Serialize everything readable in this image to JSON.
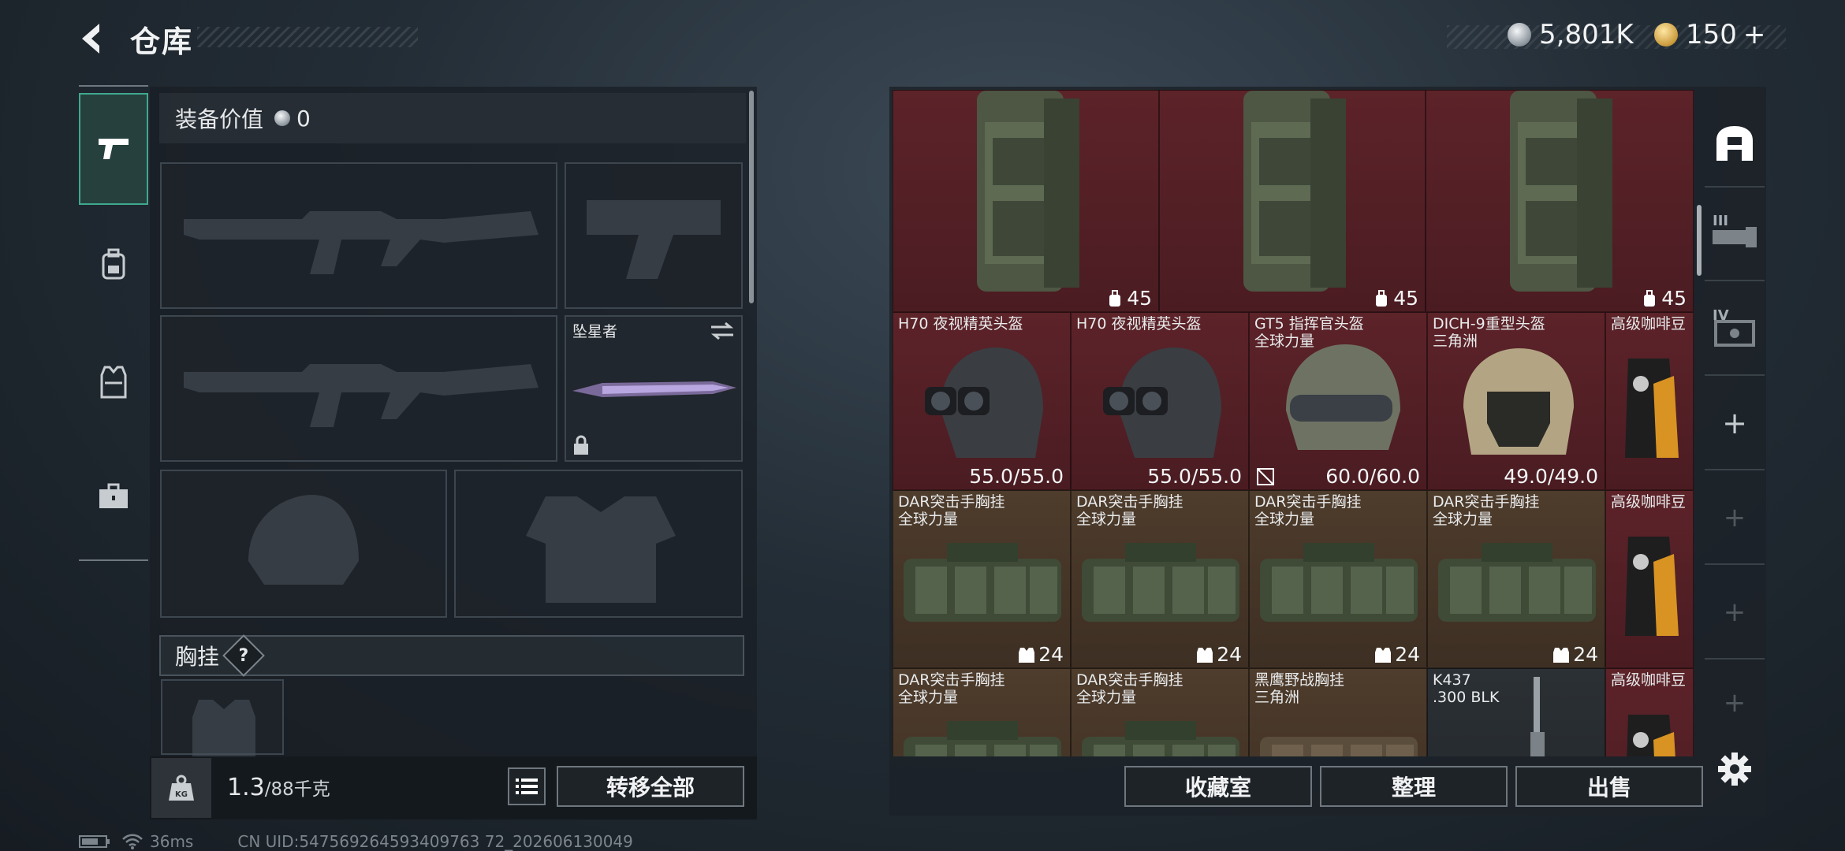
{
  "header": {
    "title": "仓库",
    "silver": "5,801K",
    "gold": "150",
    "add_label": "+"
  },
  "left_panel": {
    "value_label": "装备价值",
    "value_amount": "0",
    "melee_name": "坠星者",
    "chest_rig_label": "胸挂",
    "chest_rig_help": "?",
    "weight_current": "1.3",
    "weight_max": "/88千克",
    "weight_icon_text": "KG",
    "transfer_all": "转移全部"
  },
  "grid": {
    "rows": [
      [
        {
          "name": "",
          "value": "45",
          "badge": "backpack",
          "bg": "red"
        },
        {
          "name": "",
          "value": "45",
          "badge": "backpack",
          "bg": "red"
        },
        {
          "name": "",
          "value": "45",
          "badge": "backpack",
          "bg": "red"
        }
      ],
      [
        {
          "name": "H70 夜视精英头盔",
          "value": "55.0/55.0",
          "bg": "red"
        },
        {
          "name": "H70 夜视精英头盔",
          "value": "55.0/55.0",
          "bg": "red"
        },
        {
          "name": "GT5 指挥官头盔\n全球力量",
          "value": "60.0/60.0",
          "bg": "red"
        },
        {
          "name": "DICH-9重型头盔\n三角洲",
          "value": "49.0/49.0",
          "bg": "red"
        },
        {
          "name": "高级咖啡豆",
          "value": "",
          "bg": "red"
        }
      ],
      [
        {
          "name": "DAR突击手胸挂\n全球力量",
          "value": "24",
          "badge": "vest",
          "bg": "brown"
        },
        {
          "name": "DAR突击手胸挂\n全球力量",
          "value": "24",
          "badge": "vest",
          "bg": "brown"
        },
        {
          "name": "DAR突击手胸挂\n全球力量",
          "value": "24",
          "badge": "vest",
          "bg": "brown"
        },
        {
          "name": "DAR突击手胸挂\n全球力量",
          "value": "24",
          "badge": "vest",
          "bg": "brown"
        },
        {
          "name": "高级咖啡豆",
          "value": "",
          "bg": "red"
        }
      ],
      [
        {
          "name": "DAR突击手胸挂\n全球力量",
          "value": "",
          "bg": "brown"
        },
        {
          "name": "DAR突击手胸挂\n全球力量",
          "value": "",
          "bg": "brown"
        },
        {
          "name": "黑鹰野战胸挂\n三角洲",
          "value": "",
          "bg": "brown"
        },
        {
          "name": "K437\n.300 BLK",
          "value": "",
          "bg": "gray"
        },
        {
          "name": "高级咖啡豆",
          "value": "",
          "bg": "red"
        }
      ]
    ]
  },
  "actions": {
    "collection": "收藏室",
    "sort": "整理",
    "sell": "出售"
  },
  "right_nav": {
    "tier3": "III",
    "tier4": "IV",
    "add": "+"
  },
  "footer": {
    "ping": "36ms",
    "uid": "CN UID:547569264593409763 72_202606130049"
  },
  "colors": {
    "accent": "#3fa88f",
    "rare_red": "#5c2329",
    "uncommon_brown": "#4e3c2c"
  }
}
